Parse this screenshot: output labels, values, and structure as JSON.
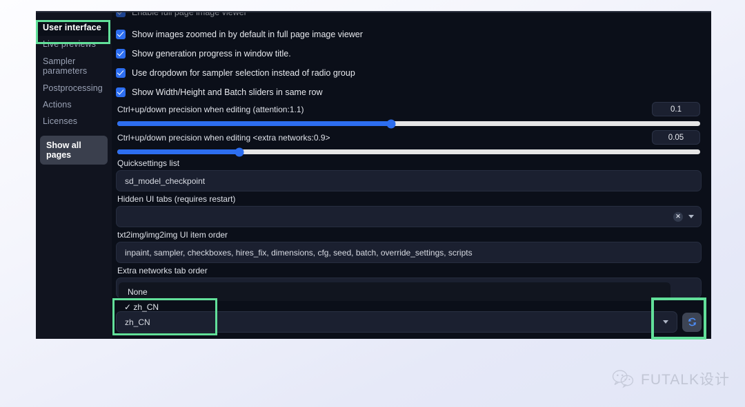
{
  "sidebar": {
    "items": [
      {
        "label": "User interface",
        "selected": true
      },
      {
        "label": "Live previews",
        "selected": false
      },
      {
        "label": "Sampler parameters",
        "selected": false
      },
      {
        "label": "Postprocessing",
        "selected": false
      },
      {
        "label": "Actions",
        "selected": false
      },
      {
        "label": "Licenses",
        "selected": false
      }
    ],
    "show_all_pages": "Show all pages"
  },
  "settings": {
    "clipped_checkbox_label": "Enable full page image viewer",
    "checkboxes": [
      {
        "label": "Show images zoomed in by default in full page image viewer",
        "checked": true
      },
      {
        "label": "Show generation progress in window title.",
        "checked": true
      },
      {
        "label": "Use dropdown for sampler selection instead of radio group",
        "checked": true
      },
      {
        "label": "Show Width/Height and Batch sliders in same row",
        "checked": true
      }
    ],
    "sliders": [
      {
        "label": "Ctrl+up/down precision when editing (attention:1.1)",
        "value": "0.1",
        "fill_percent": 47
      },
      {
        "label": "Ctrl+up/down precision when editing <extra networks:0.9>",
        "value": "0.05",
        "fill_percent": 21
      }
    ],
    "quicksettings": {
      "label": "Quicksettings list",
      "value": "sd_model_checkpoint"
    },
    "hidden_tabs": {
      "label": "Hidden UI tabs (requires restart)",
      "value": "",
      "clear_icon": "x-circle-icon",
      "caret_icon": "chevron-down-icon"
    },
    "item_order": {
      "label": "txt2img/img2img UI item order",
      "value": "inpaint, sampler, checkboxes, hires_fix, dimensions, cfg, seed, batch, override_settings, scripts"
    },
    "extra_networks": {
      "label": "Extra networks tab order"
    },
    "localization_dropdown": {
      "options": [
        {
          "label": "None",
          "checked": false
        },
        {
          "label": "zh_CN",
          "checked": true,
          "check_glyph": "✓"
        }
      ],
      "selected_value": "zh_CN",
      "caret_icon": "chevron-down-icon",
      "refresh_icon": "refresh-icon"
    }
  },
  "highlights": {
    "color": "#62e09a",
    "regions": [
      "user-interface-tab",
      "localization-dropdown",
      "refresh-button"
    ]
  },
  "watermark": {
    "text": "FUTALK设计",
    "icon": "wechat-icon"
  }
}
